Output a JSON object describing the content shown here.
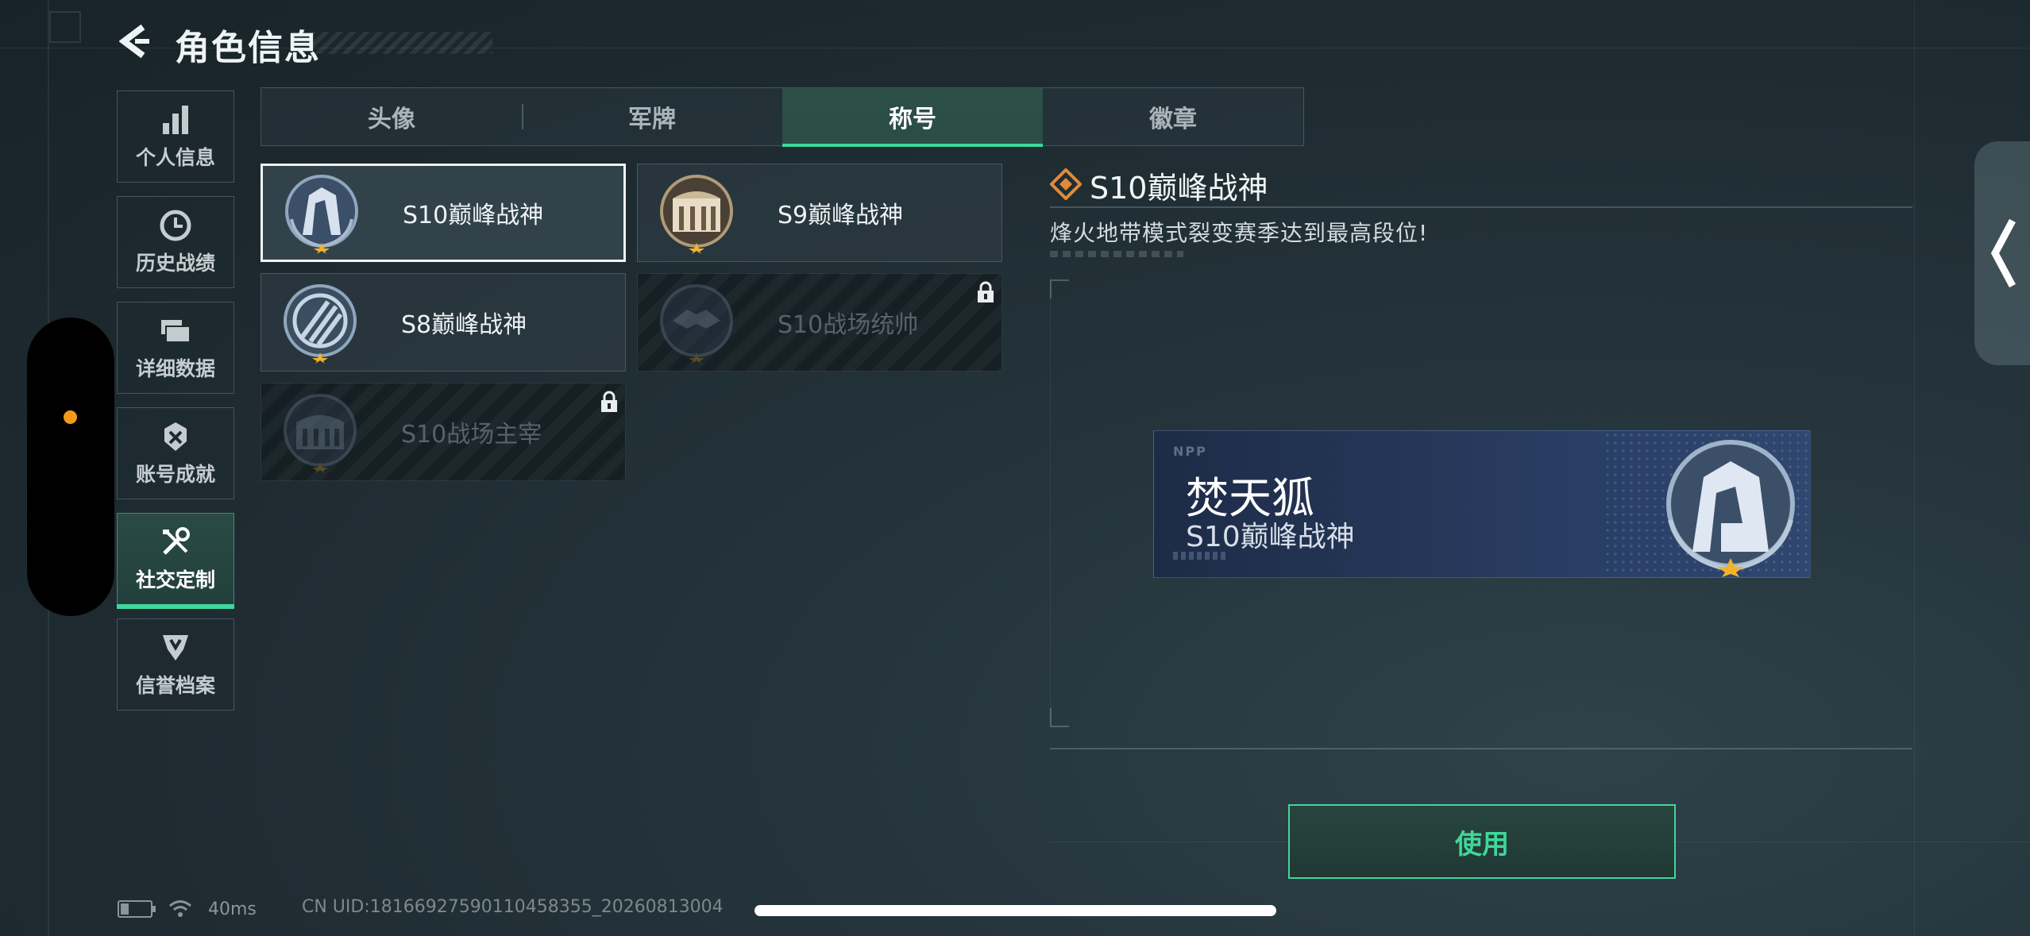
{
  "header": {
    "title": "角色信息"
  },
  "sidebar": {
    "items": [
      {
        "label": "个人信息",
        "icon": "bar-chart-icon",
        "active": false
      },
      {
        "label": "历史战绩",
        "icon": "clock-icon",
        "active": false
      },
      {
        "label": "详细数据",
        "icon": "folder-stack-icon",
        "active": false
      },
      {
        "label": "账号成就",
        "icon": "achievement-icon",
        "active": false
      },
      {
        "label": "社交定制",
        "icon": "tools-icon",
        "active": true
      },
      {
        "label": "信誉档案",
        "icon": "badge-shield-icon",
        "active": false
      }
    ]
  },
  "tabs": [
    {
      "label": "头像",
      "active": false
    },
    {
      "label": "军牌",
      "active": false
    },
    {
      "label": "称号",
      "active": true
    },
    {
      "label": "徽章",
      "active": false
    }
  ],
  "titles": [
    {
      "name": "S10巅峰战神",
      "selected": true,
      "locked": false
    },
    {
      "name": "S9巅峰战神",
      "selected": false,
      "locked": false
    },
    {
      "name": "S8巅峰战神",
      "selected": false,
      "locked": false
    },
    {
      "name": "S10战场统帅",
      "selected": false,
      "locked": true
    },
    {
      "name": "S10战场主宰",
      "selected": false,
      "locked": true
    }
  ],
  "detail": {
    "title": "S10巅峰战神",
    "description": "烽火地带模式裂变赛季达到最高段位!"
  },
  "preview": {
    "player_name": "焚天狐",
    "title": "S10巅峰战神"
  },
  "use_button": {
    "label": "使用"
  },
  "status": {
    "ping": "40ms",
    "uid": "CN UID:1816692759011045835​5_20260813004"
  },
  "colors": {
    "accent": "#3fd79a",
    "orange": "#f39a1a"
  }
}
